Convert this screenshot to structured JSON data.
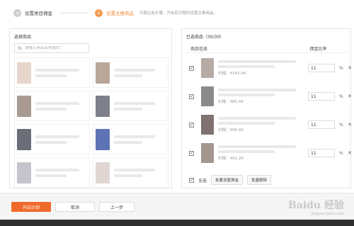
{
  "steps": [
    {
      "label": "设置类目佣金",
      "icon": "check-icon",
      "state": "done"
    },
    {
      "label": "设置主推商品",
      "number": "2",
      "state": "active",
      "hint": "可跳过此步骤，开启后可随时设置主推商品。"
    }
  ],
  "left_panel": {
    "title": "选择商品",
    "search_placeholder": "请输入商品名称或ID"
  },
  "right_panel": {
    "title": "已选商品（30/30）",
    "col_info": "商品信息",
    "col_rate": "佣金比率",
    "items": [
      {
        "price": "价格：¥143.04",
        "rate": "11",
        "unit": "%",
        "checked": true
      },
      {
        "price": "价格：¥85.44",
        "rate": "11",
        "unit": "%",
        "checked": true
      },
      {
        "price": "价格：¥96.40",
        "rate": "11",
        "unit": "%",
        "checked": true
      },
      {
        "price": "价格：¥91.20",
        "rate": "11",
        "unit": "%",
        "checked": true
      }
    ],
    "select_all": "全选",
    "batch_set": "批量设置佣金",
    "batch_delete": "批量删除"
  },
  "footer": {
    "start": "开启计划",
    "cancel": "取消",
    "prev": "上一步"
  },
  "watermark": {
    "brand": "Baidu 经验",
    "sub": "jingyan.baidu.com"
  },
  "colors": {
    "accent": "#f06a2b",
    "step_active": "#f39c51"
  }
}
